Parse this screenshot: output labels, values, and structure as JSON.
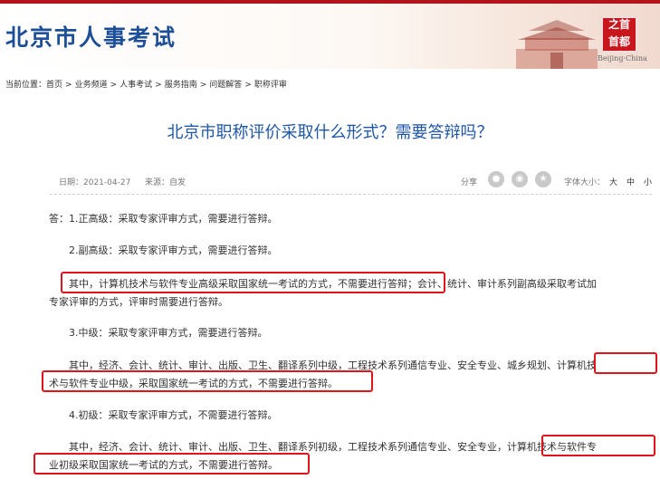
{
  "header": {
    "site_title": "北京市人事考试",
    "seal_line1": "之首",
    "seal_line2": "首都",
    "seal_caption": "Beijing·China"
  },
  "breadcrumb": {
    "prefix": "当前位置：",
    "items": [
      "首页",
      "业务频道",
      "人事考试",
      "服务指南",
      "问题解答",
      "职称评审"
    ],
    "separator": ">"
  },
  "article": {
    "title": "北京市职称评价采取什么形式？需要答辩吗？",
    "date": "日期：2021-04-27",
    "source": "来源：自发",
    "share_label": "分享",
    "share_icons": [
      "wechat-icon",
      "weibo-icon",
      "qzone-icon"
    ],
    "font_size_label": "字体大小：",
    "font_sizes": [
      "大",
      "中",
      "小"
    ],
    "paragraphs": {
      "p1": "答：1.正高级：采取专家评审方式，需要进行答辩。",
      "p2": "2.副高级：采取专家评审方式，需要进行答辩。",
      "p3a": "其中，计算机技术与软件专业高级采取国家统一考试的方式，不需要进行答辩；会计、统计、审计系列副高级采取考试加",
      "p3b": "专家评审的方式，评审时需要进行答辩。",
      "p4": "3.中级：采取专家评审方式，需要进行答辩。",
      "p5a": "其中，经济、会计、统计、审计、出版、卫生、翻译系列中级，工程技术系列通信专业、安全专业、城乡规划、计算机技",
      "p5b": "术与软件专业中级，采取国家统一考试的方式，不需要进行答辩。",
      "p6": "4.初级：采取专家评审方式，不需要进行答辩。",
      "p7a": "其中，经济、会计、统计、审计、出版、卫生、翻译系列初级，工程技术系列通信专业、安全专业，计算机技术与软件专",
      "p7b": "业初级采取国家统一考试的方式，不需要进行答辩。"
    }
  },
  "colors": {
    "brand_blue": "#1d4f99",
    "title_blue": "#1f57a8",
    "highlight_red": "#e0141b",
    "top_red": "#b3141c"
  }
}
